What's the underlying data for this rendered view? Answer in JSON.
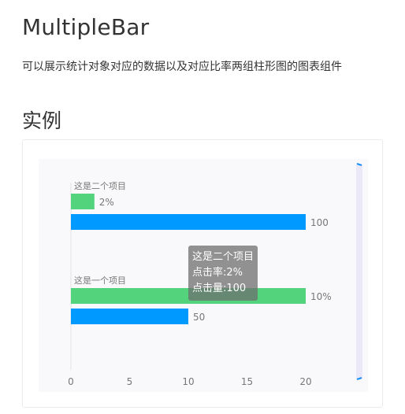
{
  "page": {
    "title": "MultipleBar",
    "description": "可以展示统计对象对应的数据以及对应比率两组柱形图的图表组件",
    "section_title": "实例"
  },
  "colors": {
    "rate_bar": "#52d37c",
    "count_bar": "#0099ff",
    "axis_text": "#777777",
    "scroll_accent": "#1890ff"
  },
  "tooltip": {
    "name": "这是二个项目",
    "rate": "点击率:2%",
    "count": "点击量:100"
  },
  "chart_data": {
    "type": "bar",
    "orientation": "horizontal",
    "categories": [
      "这是二个项目",
      "这是一个项目"
    ],
    "series": [
      {
        "values": [
          2,
          20
        ],
        "labels": [
          "2%",
          "10%"
        ]
      },
      {
        "values": [
          20,
          10
        ],
        "labels": [
          "100",
          "50"
        ]
      }
    ],
    "xlim": [
      0,
      20
    ],
    "xticks": [
      "0",
      "5",
      "10",
      "15",
      "20"
    ]
  }
}
